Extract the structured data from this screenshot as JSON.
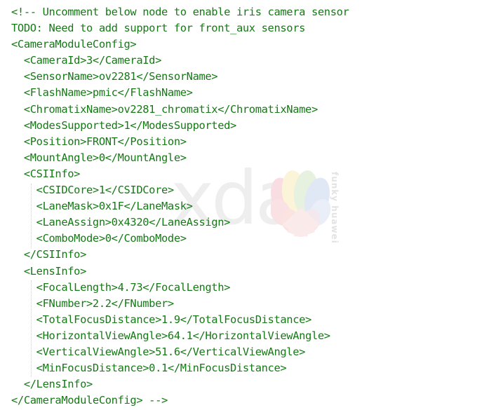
{
  "document": {
    "title": "CameraModuleConfig XML snippet",
    "language": "xml",
    "text_color": "#157a15",
    "background_color": "#ffffff",
    "font_kind": "monospace",
    "indent_unit": "  "
  },
  "watermarks": {
    "xda": {
      "text": "xda",
      "color": "#eeeeee"
    },
    "funky_huawei": {
      "text": "funky huawei",
      "color": "#e3e3e3"
    },
    "huawei_flower": {
      "petal_colors": [
        "#f9dfe3",
        "#fbf3d6",
        "#e3efdd",
        "#dfe6f4",
        "#f6dde2",
        "#f9e4e0",
        "#eef5e6",
        "#e5ecf7"
      ],
      "center_color": "#fbe5e6"
    }
  },
  "code": {
    "lines": [
      "<!-- Uncomment below node to enable iris camera sensor",
      "TODO: Need to add support for front_aux sensors",
      "<CameraModuleConfig>",
      "  <CameraId>3</CameraId>",
      "  <SensorName>ov2281</SensorName>",
      "  <FlashName>pmic</FlashName>",
      "  <ChromatixName>ov2281_chromatix</ChromatixName>",
      "  <ModesSupported>1</ModesSupported>",
      "  <Position>FRONT</Position>",
      "  <MountAngle>0</MountAngle>",
      "  <CSIInfo>",
      "    <CSIDCore>1</CSIDCore>",
      "    <LaneMask>0x1F</LaneMask>",
      "    <LaneAssign>0x4320</LaneAssign>",
      "    <ComboMode>0</ComboMode>",
      "  </CSIInfo>",
      "  <LensInfo>",
      "    <FocalLength>4.73</FocalLength>",
      "    <FNumber>2.2</FNumber>",
      "    <TotalFocusDistance>1.9</TotalFocusDistance>",
      "    <HorizontalViewAngle>64.1</HorizontalViewAngle>",
      "    <VerticalViewAngle>51.6</VerticalViewAngle>",
      "    <MinFocusDistance>0.1</MinFocusDistance>",
      "  </LensInfo>",
      "</CameraModuleConfig> -->"
    ],
    "values": {
      "CameraId": "3",
      "SensorName": "ov2281",
      "FlashName": "pmic",
      "ChromatixName": "ov2281_chromatix",
      "ModesSupported": "1",
      "Position": "FRONT",
      "MountAngle": "0",
      "CSIDCore": "1",
      "LaneMask": "0x1F",
      "LaneAssign": "0x4320",
      "ComboMode": "0",
      "FocalLength": "4.73",
      "FNumber": "2.2",
      "TotalFocusDistance": "1.9",
      "HorizontalViewAngle": "64.1",
      "VerticalViewAngle": "51.6",
      "MinFocusDistance": "0.1"
    },
    "comment_open": "<!--",
    "comment_close": "-->"
  }
}
